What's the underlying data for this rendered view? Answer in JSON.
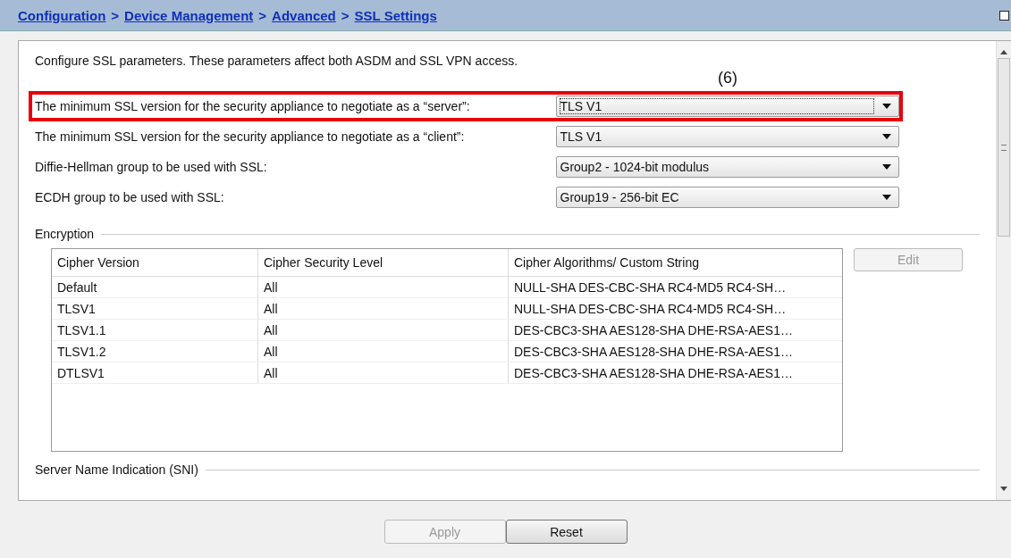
{
  "breadcrumb": {
    "links": [
      {
        "label": "Configuration"
      },
      {
        "label": "Device Management"
      },
      {
        "label": "Advanced"
      },
      {
        "label": "SSL Settings"
      }
    ],
    "separator": ">"
  },
  "intro": "Configure SSL parameters. These parameters affect both ASDM and SSL VPN access.",
  "annotation": "(6)",
  "settings": [
    {
      "label": "The minimum SSL version for the security appliance to negotiate as a “server”:",
      "value": "TLS V1",
      "highlighted": true
    },
    {
      "label": "The minimum SSL version for the security appliance to negotiate as a “client”:",
      "value": "TLS V1",
      "highlighted": false
    },
    {
      "label": "Diffie-Hellman group to be used with SSL:",
      "value": "Group2 - 1024-bit modulus",
      "highlighted": false
    },
    {
      "label": "ECDH group to be used with SSL:",
      "value": "Group19 - 256-bit EC",
      "highlighted": false
    }
  ],
  "encryption": {
    "title": "Encryption",
    "columns": [
      "Cipher Version",
      "Cipher Security Level",
      "Cipher Algorithms/ Custom String"
    ],
    "rows": [
      [
        "Default",
        "All",
        "NULL-SHA DES-CBC-SHA RC4-MD5 RC4-SH…"
      ],
      [
        "TLSV1",
        "All",
        "NULL-SHA DES-CBC-SHA RC4-MD5 RC4-SH…"
      ],
      [
        "TLSV1.1",
        "All",
        "DES-CBC3-SHA AES128-SHA DHE-RSA-AES1…"
      ],
      [
        "TLSV1.2",
        "All",
        "DES-CBC3-SHA AES128-SHA DHE-RSA-AES1…"
      ],
      [
        "DTLSV1",
        "All",
        "DES-CBC3-SHA AES128-SHA DHE-RSA-AES1…"
      ]
    ],
    "edit_button": {
      "label": "Edit",
      "disabled": true
    }
  },
  "sni": {
    "title": "Server Name Indication (SNI)"
  },
  "buttons": [
    {
      "label": "Apply",
      "disabled": true
    },
    {
      "label": "Reset",
      "disabled": false
    }
  ]
}
